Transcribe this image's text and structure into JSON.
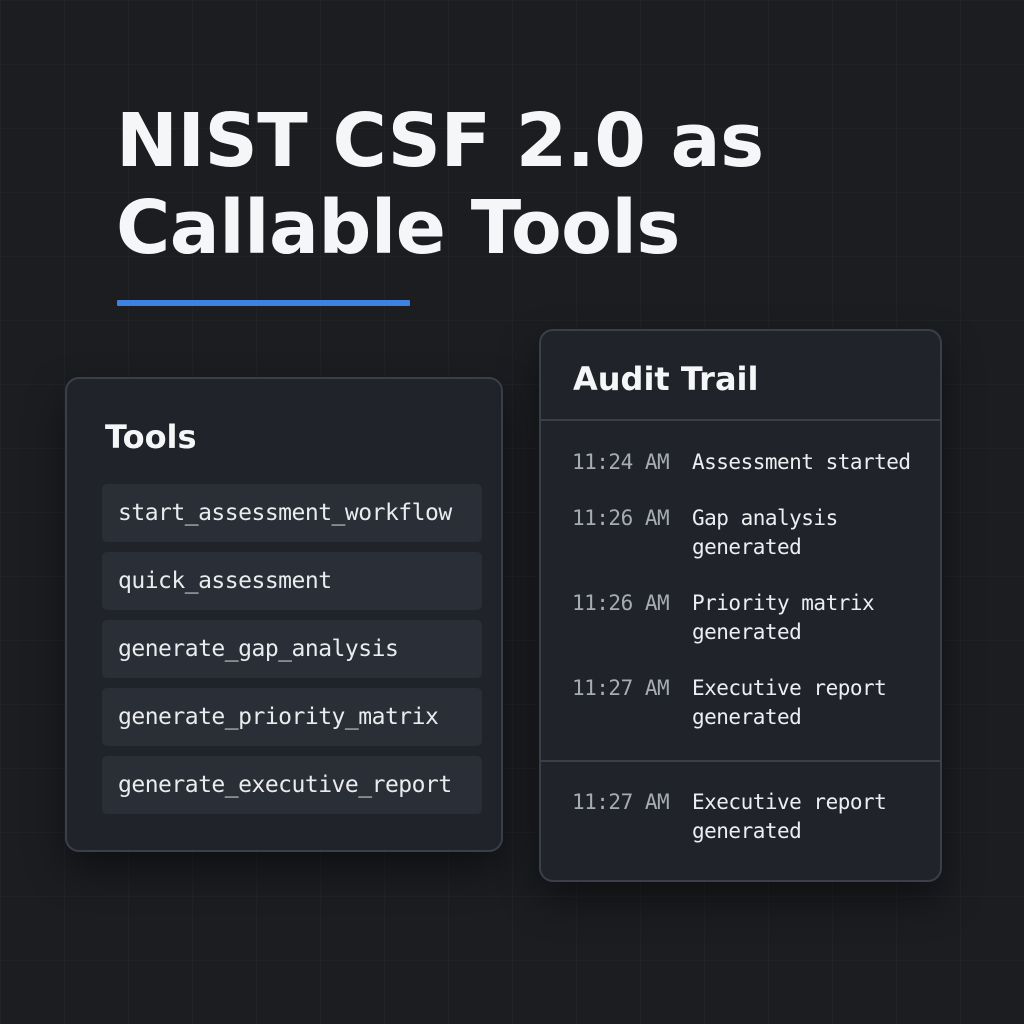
{
  "header": {
    "title_line_1": "NIST CSF 2.0 as",
    "title_line_2": "Callable Tools",
    "accent_color": "#3d82e0"
  },
  "tools_panel": {
    "heading": "Tools",
    "items": [
      {
        "label": "start_assessment_workflow"
      },
      {
        "label": "quick_assessment"
      },
      {
        "label": "generate_gap_analysis"
      },
      {
        "label": "generate_priority_matrix"
      },
      {
        "label": "generate_executive_report"
      }
    ]
  },
  "audit_panel": {
    "heading": "Audit Trail",
    "entries": [
      {
        "time": "11:24 AM",
        "event": "Assessment started"
      },
      {
        "time": "11:26 AM",
        "event": "Gap analysis generated"
      },
      {
        "time": "11:26 AM",
        "event": "Priority matrix generated"
      },
      {
        "time": "11:27 AM",
        "event": "Executive report generated"
      },
      {
        "time": "11:27 AM",
        "event": "Executive report generated"
      }
    ]
  }
}
